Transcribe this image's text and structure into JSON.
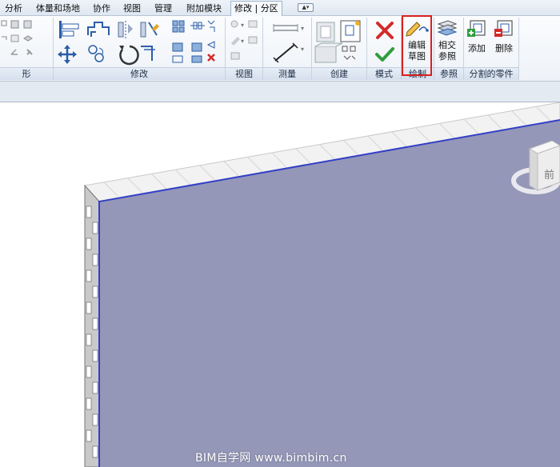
{
  "tabs": [
    {
      "label": "分析"
    },
    {
      "label": "体量和场地"
    },
    {
      "label": "协作"
    },
    {
      "label": "视图"
    },
    {
      "label": "管理"
    },
    {
      "label": "附加模块"
    },
    {
      "label": "修改 | 分区"
    }
  ],
  "panels": {
    "shape": "形",
    "modify": "修改",
    "view": "视图",
    "measure": "测量",
    "create": "创建",
    "mode": "模式",
    "draw": "绘制",
    "reference": "参照",
    "divided_parts": "分割的零件"
  },
  "buttons": {
    "edit_sketch": {
      "line1": "编辑",
      "line2": "草图"
    },
    "intersect_reference": {
      "line1": "相交",
      "line2": "参照"
    },
    "add": "添加",
    "delete": "删除"
  },
  "colors": {
    "red_highlight": "#d9201f",
    "wall_face": "#9497b8",
    "wall_edge": "#3340c6",
    "cancel_red": "#d42a2a",
    "finish_green": "#2f9e3c"
  },
  "viewcube": {
    "label": "前"
  },
  "watermark": "BIM自学网 www.bimbim.cn"
}
